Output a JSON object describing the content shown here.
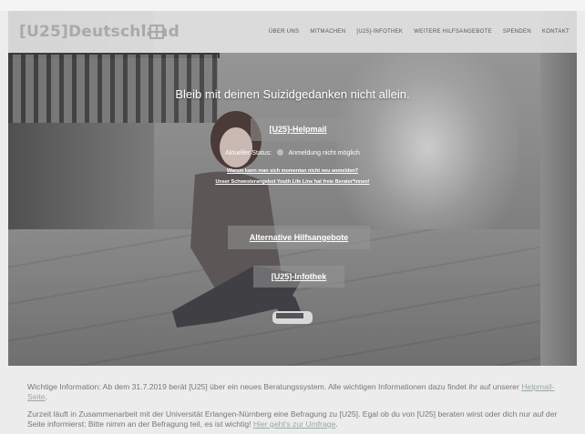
{
  "header": {
    "logo_text": "[U25]Deutschland",
    "logo_reg": "®",
    "nav": [
      "ÜBER UNS",
      "MITMACHEN",
      "[U25]-INFOTHEK",
      "WEITERE HILFSANGEBOTE",
      "SPENDEN",
      "KONTAKT"
    ]
  },
  "hero": {
    "headline": "Bleib mit deinen Suizidgedanken nicht allein.",
    "helpmail_button": "[U25]-Helpmail",
    "status_label": "Aktueller Status:",
    "status_value": "Anmeldung nicht möglich",
    "link_why": "Warum kann man sich momentan nicht neu anmelden?",
    "link_youth": "Unser Schwesterangebot Youth Life Line hat freie Berater*innen!",
    "alt_button": "Alternative Hilfsangebote",
    "infothek_button": "[U25]-Infothek"
  },
  "info": {
    "p1_text": "Wichtige Information: Ab dem 31.7.2019 berät [U25] über ein neues Beratungssystem. Alle wichtigen Informationen dazu findet ihr auf unserer ",
    "p1_link": "Helpmail-Seite",
    "p1_end": ".",
    "p2_text": "Zurzeit läuft in Zusammenarbeit mit der Universität Erlangen-Nürnberg eine Befragung zu [U25]. Egal ob du von [U25] beraten wirst oder dich nur auf der Seite informierst: Bitte nimm an der Befragung teil, es ist wichtig! ",
    "p2_link": "Hier geht's zur Umfrage",
    "p2_end": "."
  }
}
